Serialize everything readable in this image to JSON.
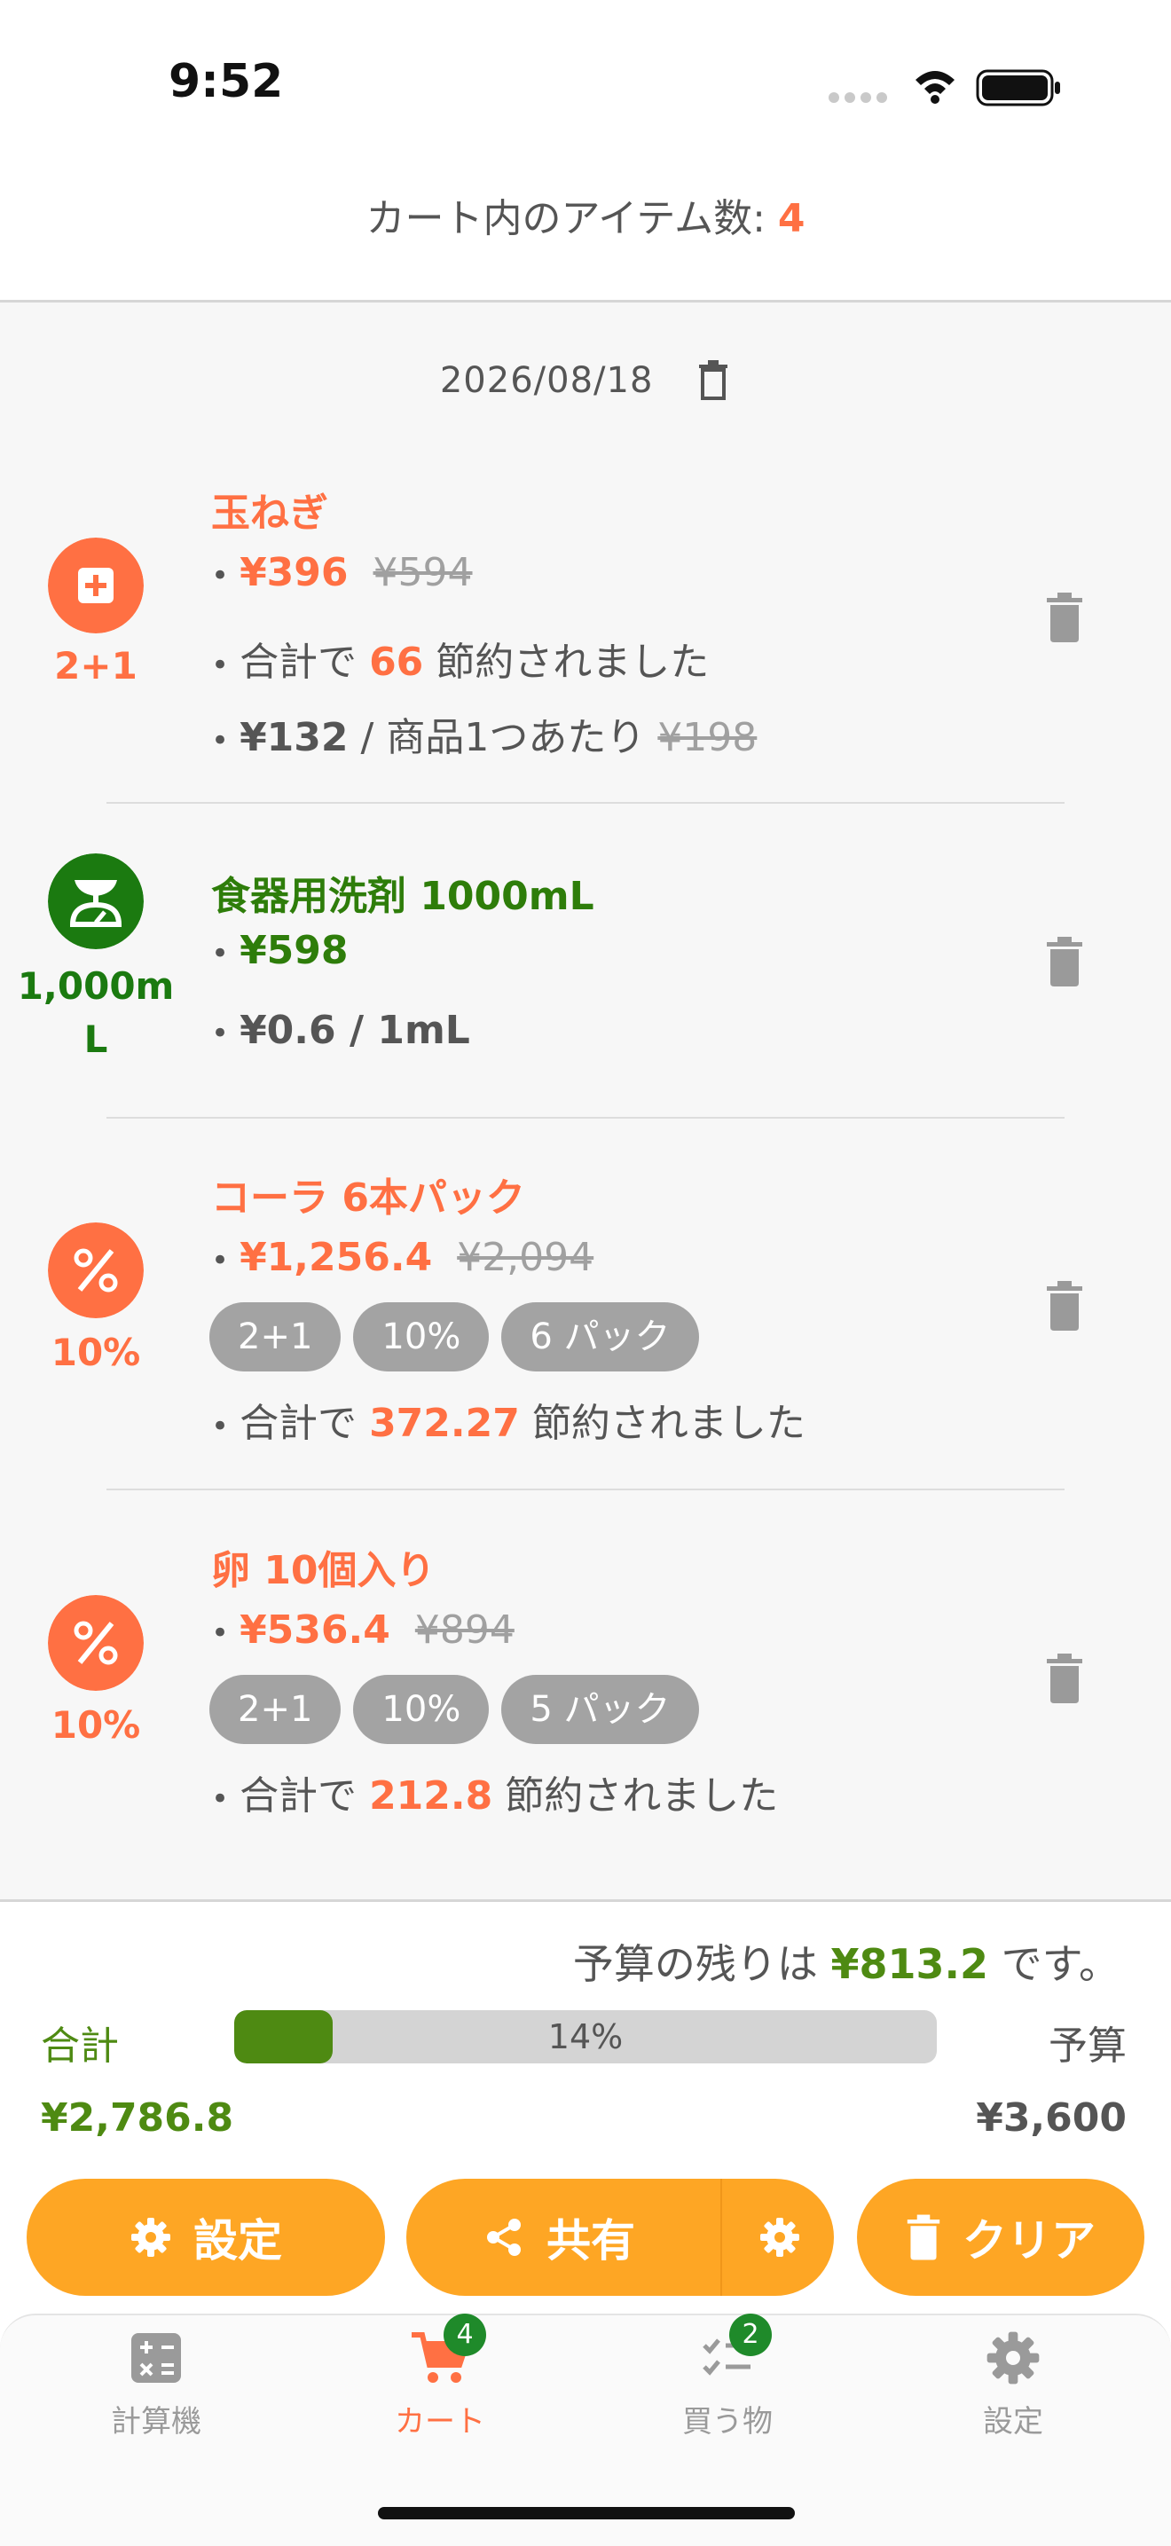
{
  "status_bar": {
    "time": "9:52"
  },
  "header": {
    "label": "カート内のアイテム数: ",
    "count": "4"
  },
  "list": {
    "date": "2026/08/18",
    "items": [
      {
        "badge": "2+1",
        "badge_icon": "plus-box-icon",
        "title": "玉ねぎ",
        "price": "¥396",
        "original_price": "¥594",
        "savings_prefix": "合計で ",
        "savings_amount": "66",
        "savings_suffix": " 節約されました",
        "unit_price": "¥132",
        "unit_sep": " / 商品1つあたり ",
        "unit_original": "¥198"
      },
      {
        "badge": "1,000mL",
        "badge_line1": "1,000m",
        "badge_line2": "L",
        "badge_icon": "scale-icon",
        "title": "食器用洗剤 1000mL",
        "price": "¥598",
        "unit_price": "¥0.6",
        "unit_sep": " / 1mL"
      },
      {
        "badge": "10%",
        "badge_icon": "percent-icon",
        "title": "コーラ 6本パック",
        "price": "¥1,256.4",
        "original_price": "¥2,094",
        "chips": [
          "2+1",
          "10%",
          "6 パック"
        ],
        "savings_prefix": "合計で ",
        "savings_amount": "372.27",
        "savings_suffix": " 節約されました"
      },
      {
        "badge": "10%",
        "badge_icon": "percent-icon",
        "title": "卵 10個入り",
        "price": "¥536.4",
        "original_price": "¥894",
        "chips": [
          "2+1",
          "10%",
          "5 パック"
        ],
        "savings_prefix": "合計で ",
        "savings_amount": "212.8",
        "savings_suffix": " 節約されました"
      }
    ]
  },
  "budget": {
    "remaining_prefix": "予算の残りは ",
    "remaining_amount": "¥813.2",
    "remaining_suffix": " です。",
    "total_label": "合計",
    "budget_label": "予算",
    "progress_text": "14%",
    "progress_fraction": 0.14,
    "total_value": "¥2,786.8",
    "budget_value": "¥3,600"
  },
  "actions": {
    "settings": "設定",
    "share": "共有",
    "clear": "クリア"
  },
  "tabs": [
    {
      "label": "計算機",
      "icon": "calculator-icon"
    },
    {
      "label": "カート",
      "icon": "cart-icon",
      "badge": "4",
      "active": true
    },
    {
      "label": "買う物",
      "icon": "checklist-icon",
      "badge": "2"
    },
    {
      "label": "設定",
      "icon": "gear-icon"
    }
  ],
  "colors": {
    "accent_orange": "#ff7043",
    "accent_green": "#2e7d0a",
    "budget_green": "#4e8a12",
    "button_orange": "#fea624",
    "chip_gray": "#a3a3a3"
  }
}
